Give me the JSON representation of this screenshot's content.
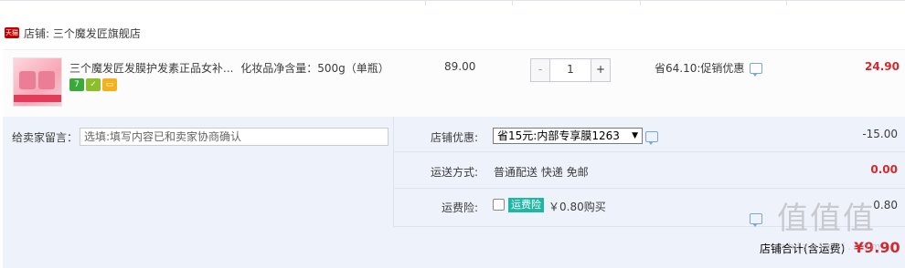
{
  "shop": {
    "badge": "天猫",
    "label": "店铺: 三个魔发匠旗舰店"
  },
  "item": {
    "title": "三个魔发匠发膜护发素正品女补...",
    "spec": "化妆品净含量：500g（单瓶）",
    "price": "89.00",
    "quantity": "1",
    "minus": "-",
    "plus": "+",
    "promo": "省64.10:促销优惠",
    "subtotal": "24.90",
    "badges": [
      {
        "text": "7",
        "color": "#3aa83b"
      },
      {
        "text": "✓",
        "color": "#8bbf2a"
      },
      {
        "text": "▭",
        "color": "#f2b11d"
      }
    ]
  },
  "order": {
    "message_label": "给卖家留言：",
    "message_placeholder": "选填:填写内容已和卖家协商确认",
    "discount_label": "店铺优惠:",
    "discount_selected": "省15元:内部专享膜1263",
    "discount_value": "-15.00",
    "shipping_label": "运送方式:",
    "shipping_text": "普通配送 快递 免邮",
    "shipping_value": "0.00",
    "insurance_label": "运费险:",
    "insurance_tag": "运费险",
    "insurance_price": "￥0.80购买",
    "insurance_value": "0.80",
    "total_label": "店铺合计(含运费)",
    "total_value": "¥9.90"
  },
  "colors": {
    "price_red": "#d4282d",
    "panel_bg": "#eef3fb",
    "ins_tag": "#1fb7a4",
    "tmall": "#c40000"
  }
}
